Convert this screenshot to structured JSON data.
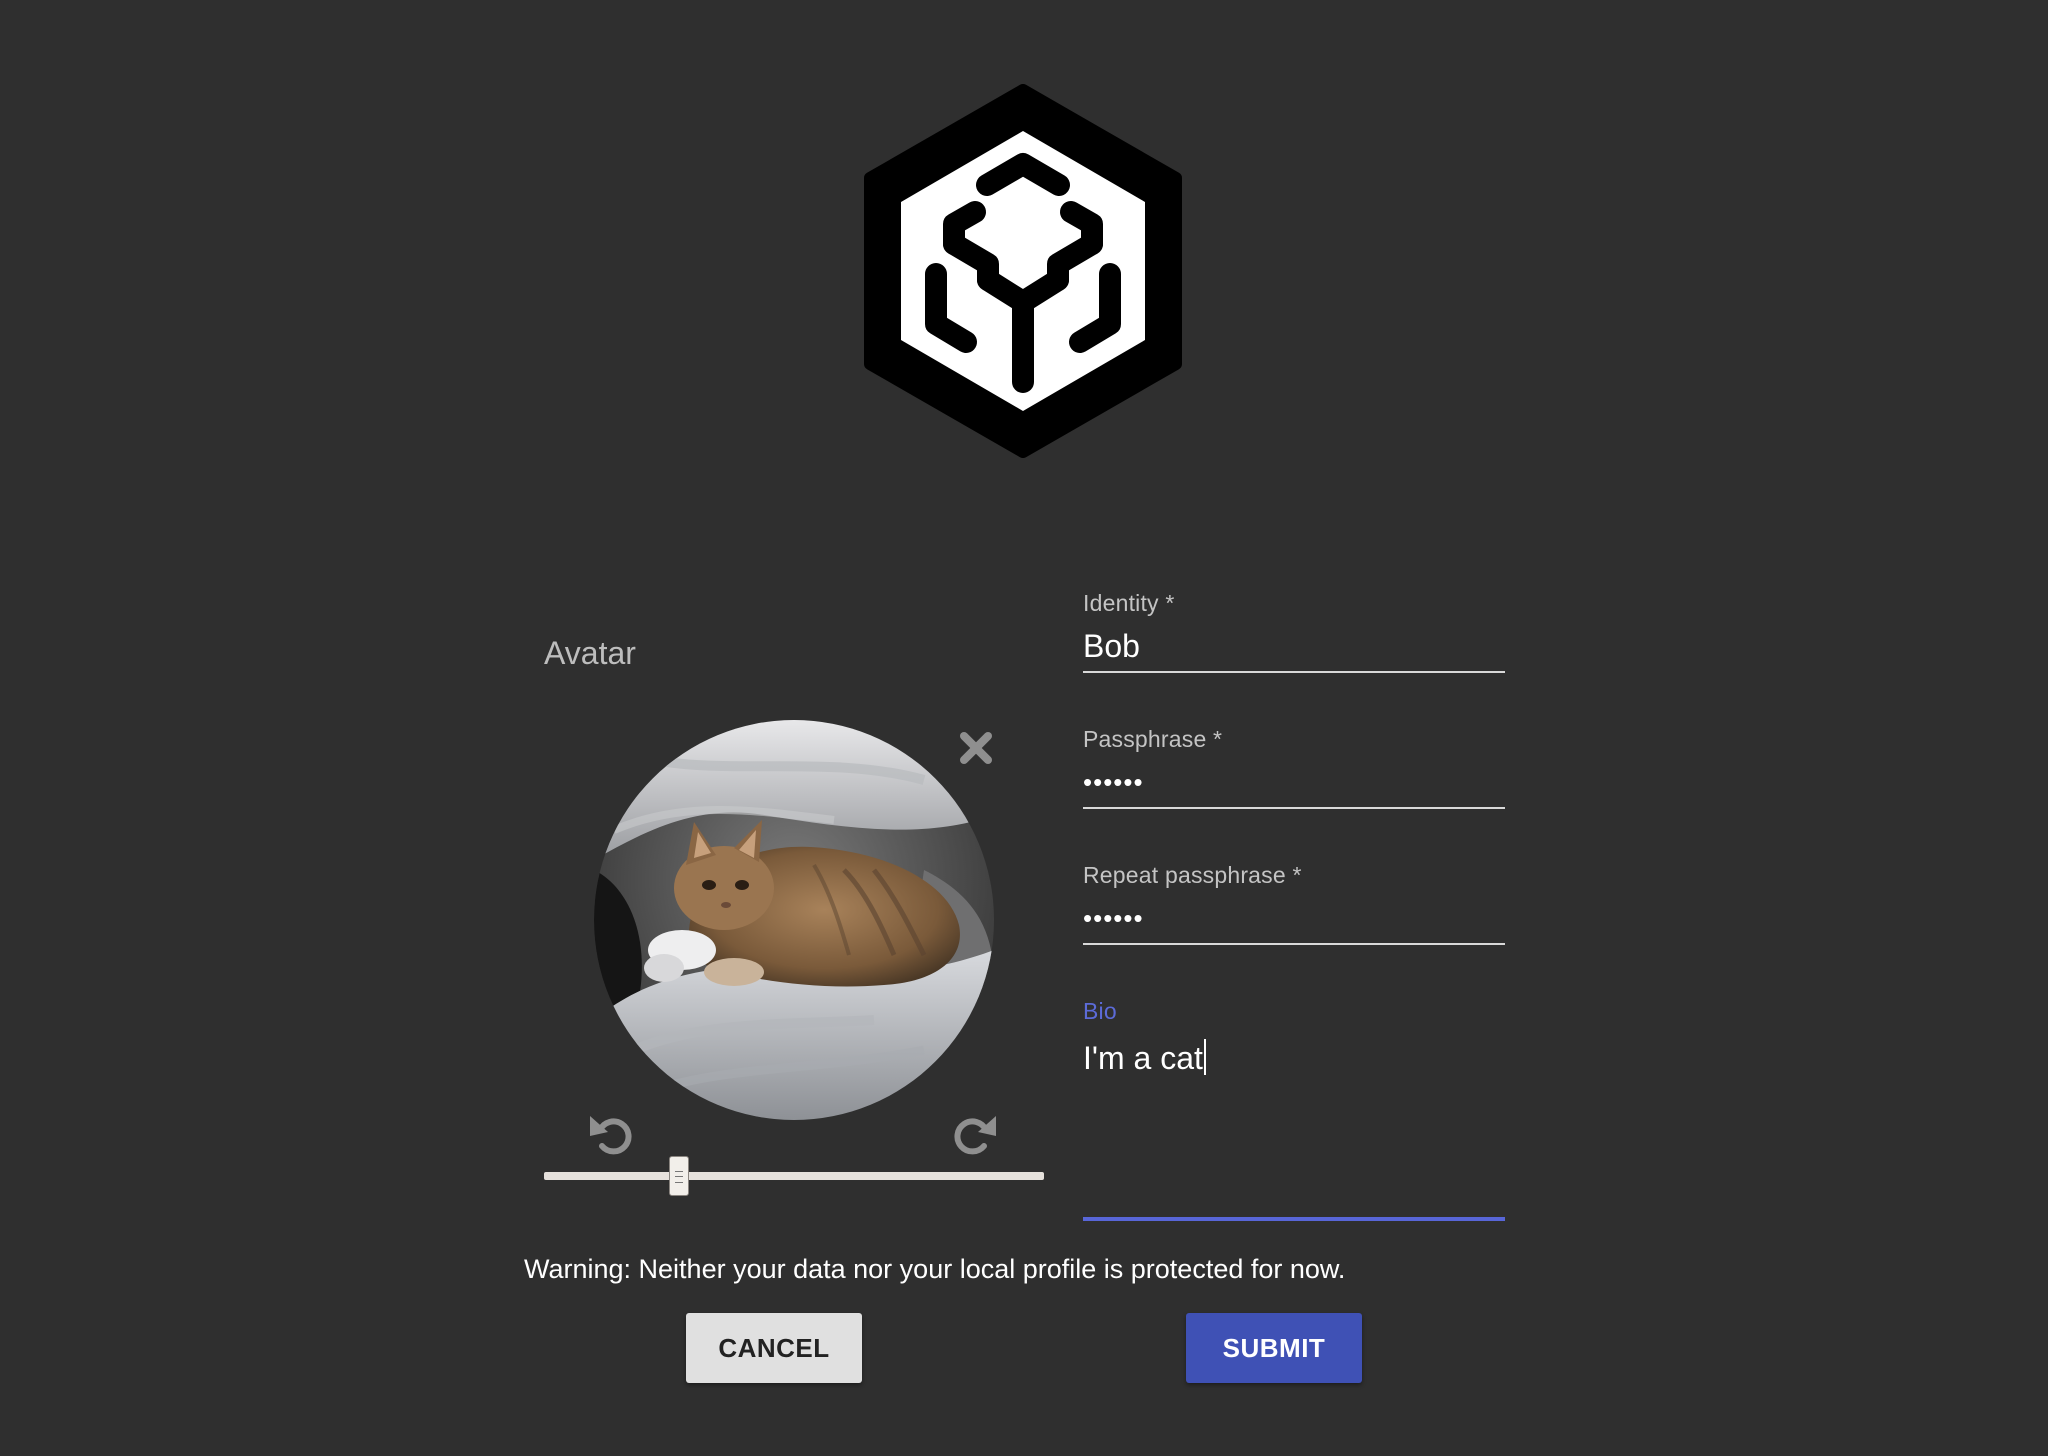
{
  "app": {
    "logo_icon": "hexagon-maze-logo"
  },
  "avatar": {
    "label": "Avatar",
    "remove_icon": "close-icon",
    "rotate_left_icon": "rotate-left-icon",
    "rotate_right_icon": "rotate-right-icon",
    "zoom_fraction": 0.26
  },
  "form": {
    "identity": {
      "label": "Identity *",
      "value": "Bob"
    },
    "passphrase": {
      "label": "Passphrase *",
      "value": "••••••"
    },
    "repeat_passphrase": {
      "label": "Repeat passphrase *",
      "value": "••••••"
    },
    "bio": {
      "label": "Bio",
      "value": "I'm a cat"
    }
  },
  "warning": "Warning: Neither your data nor your local profile is protected for now.",
  "buttons": {
    "cancel": "CANCEL",
    "submit": "SUBMIT"
  },
  "colors": {
    "background": "#2f2f2f",
    "accent": "#3f51b5",
    "focus": "#5c6bd8"
  }
}
